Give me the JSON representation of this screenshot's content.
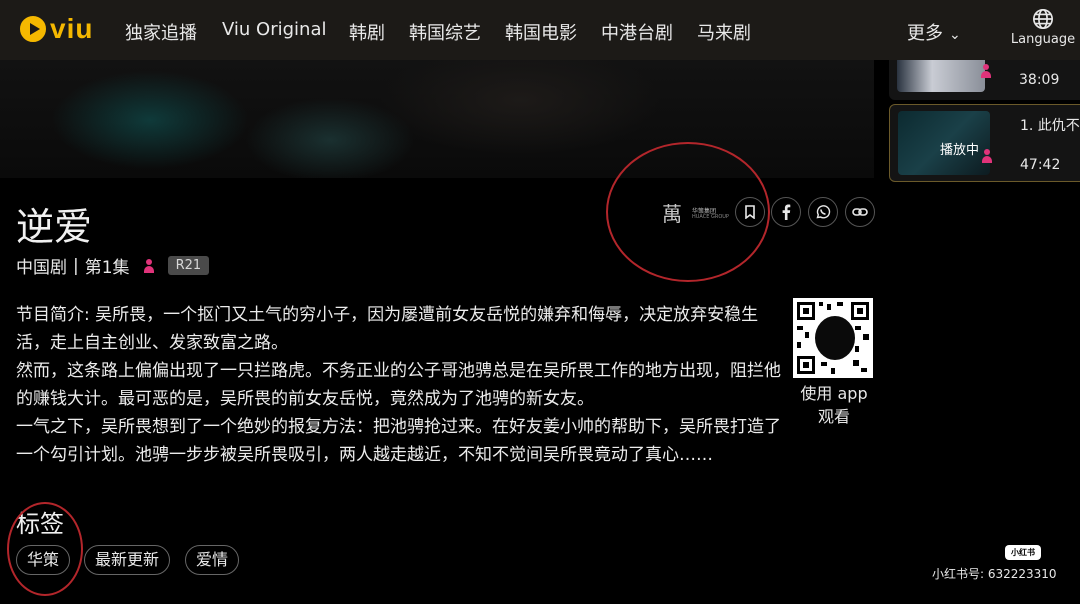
{
  "nav": {
    "logo_text": "viu",
    "items": [
      "独家追播",
      "Viu Original",
      "韩剧",
      "韩国综艺",
      "韩国电影",
      "中港台剧",
      "马来剧"
    ],
    "more_label": "更多",
    "language_label": "Language"
  },
  "sidebar": {
    "prev_duration": "38:09",
    "current_title": "1. 此仇不",
    "current_status": "播放中",
    "current_duration": "47:42"
  },
  "show": {
    "title": "逆爱",
    "category": "中国剧",
    "separator": "|",
    "episode": "第1集",
    "rating": "R21",
    "producer_name": "华策集团",
    "producer_sub": "HUACE GROUP"
  },
  "description": {
    "lines": [
      "节目简介: 吴所畏，一个抠门又土气的穷小子，因为屡遭前女友岳悦的嫌弃和侮辱，决定放弃安稳生活，走上自主创业、发家致富之路。",
      "然而，这条路上偏偏出现了一只拦路虎。不务正业的公子哥池骋总是在吴所畏工作的地方出现，阻拦他的赚钱大计。最可恶的是，吴所畏的前女友岳悦，竟然成为了池骋的新女友。",
      "一气之下，吴所畏想到了一个绝妙的报复方法：把池骋抢过来。在好友姜小帅的帮助下，吴所畏打造了一个勾引计划。池骋一步步被吴所畏吸引，两人越走越近，不知不觉间吴所畏竟动了真心……"
    ]
  },
  "app": {
    "label_line1": "使用 app",
    "label_line2": "观看"
  },
  "tags": {
    "title": "标签",
    "items": [
      "华策",
      "最新更新",
      "爱情"
    ]
  },
  "watermark": {
    "badge": "小红书",
    "text": "小红书号: 632223310"
  },
  "colors": {
    "brand": "#f5b800",
    "nav_bg": "#1c1a17",
    "annotation_red": "#b3262b",
    "pink": "#e0337a"
  }
}
